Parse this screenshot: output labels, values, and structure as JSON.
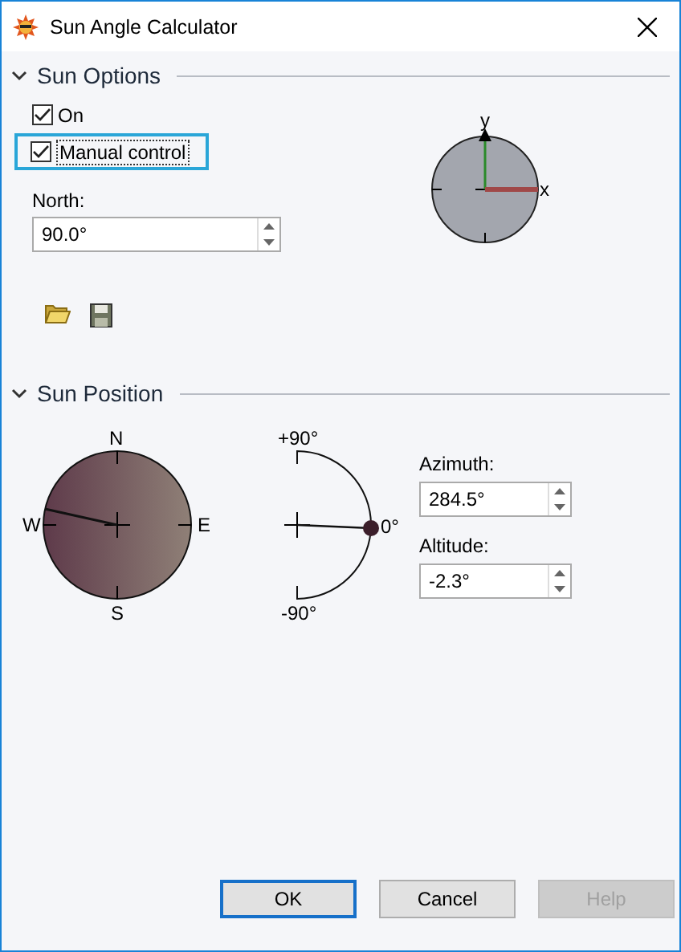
{
  "window": {
    "title": "Sun Angle Calculator"
  },
  "sun_options": {
    "title": "Sun Options",
    "expanded": true,
    "checkboxes": [
      {
        "label": "On",
        "checked": true,
        "focused": false
      },
      {
        "label": "Manual control",
        "checked": true,
        "focused": true
      }
    ],
    "north": {
      "label": "North:",
      "value": "90.0°"
    },
    "axes": {
      "y_label": "y",
      "x_label": "x"
    }
  },
  "sun_position": {
    "title": "Sun Position",
    "expanded": true,
    "compass": {
      "north": "N",
      "east": "E",
      "south": "S",
      "west": "W"
    },
    "altitude_dial": {
      "top": "+90°",
      "middle": "0°",
      "bottom": "-90°"
    },
    "azimuth": {
      "label": "Azimuth:",
      "value": "284.5°"
    },
    "altitude": {
      "label": "Altitude:",
      "value": "-2.3°"
    }
  },
  "buttons": [
    {
      "label": "OK",
      "default": true,
      "disabled": false
    },
    {
      "label": "Cancel",
      "default": false,
      "disabled": false
    },
    {
      "label": "Help",
      "default": false,
      "disabled": true
    }
  ]
}
